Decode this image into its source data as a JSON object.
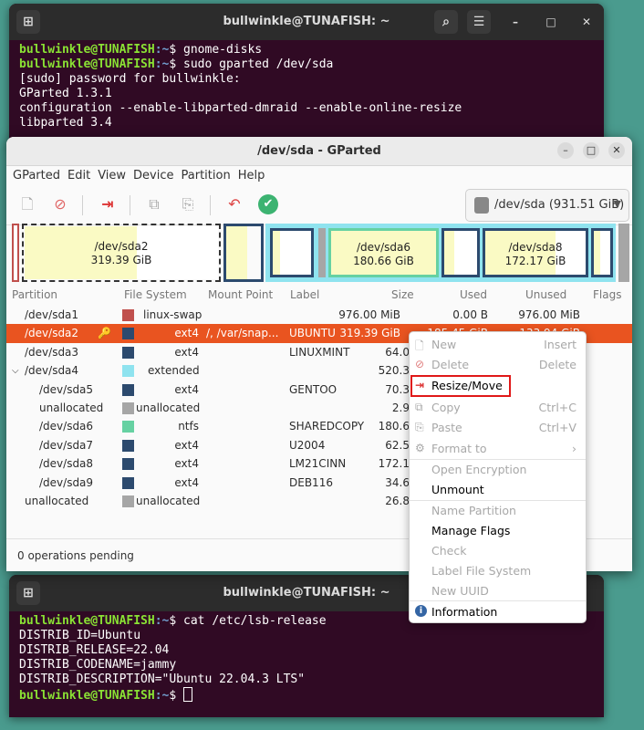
{
  "top_terminal": {
    "title": "bullwinkle@TUNAFISH: ~",
    "lines": [
      {
        "user": "bullwinkle@TUNAFISH",
        "path": ":~",
        "cmd": "$ gnome-disks"
      },
      {
        "user": "bullwinkle@TUNAFISH",
        "path": ":~",
        "cmd": "$ sudo gparted /dev/sda"
      },
      {
        "text": "[sudo] password for bullwinkle:"
      },
      {
        "text": "GParted 1.3.1"
      },
      {
        "text": "configuration --enable-libparted-dmraid --enable-online-resize"
      },
      {
        "text": "libparted 3.4"
      }
    ]
  },
  "gparted": {
    "title": "/dev/sda - GParted",
    "menu": [
      "GParted",
      "Edit",
      "View",
      "Device",
      "Partition",
      "Help"
    ],
    "device_selector": "/dev/sda (931.51 GiB)",
    "map": [
      {
        "name": "/dev/sda2",
        "size": "319.39 GiB"
      },
      {
        "name": "/dev/sda6",
        "size": "180.66 GiB"
      },
      {
        "name": "/dev/sda8",
        "size": "172.17 GiB"
      }
    ],
    "columns": [
      "Partition",
      "File System",
      "Mount Point",
      "Label",
      "Size",
      "Used",
      "Unused",
      "Flags"
    ],
    "rows": [
      {
        "partition": "/dev/sda1",
        "fs": "linux-swap",
        "color": "#c0504d",
        "mount": "",
        "label": "",
        "size": "976.00 MiB",
        "used": "0.00 B",
        "unused": "976.00 MiB"
      },
      {
        "partition": "/dev/sda2",
        "fs": "ext4",
        "color": "#2c4a6e",
        "mount": "/, /var/snap...",
        "label": "UBUNTU",
        "size": "319.39 GiB",
        "used": "185.45 GiB",
        "unused": "133.94 GiB"
      },
      {
        "partition": "/dev/sda3",
        "fs": "ext4",
        "color": "#2c4a6e",
        "mount": "",
        "label": "LINUXMINT",
        "size": "64.0",
        "used": "",
        "unused": ""
      },
      {
        "partition": "/dev/sda4",
        "fs": "extended",
        "color": "#8fe3ef",
        "mount": "",
        "label": "",
        "size": "520.3",
        "used": "",
        "unused": ""
      },
      {
        "partition": "/dev/sda5",
        "fs": "ext4",
        "color": "#2c4a6e",
        "mount": "",
        "label": "GENTOO",
        "size": "70.3",
        "used": "",
        "unused": ""
      },
      {
        "partition": "unallocated",
        "fs": "unallocated",
        "color": "#a6a6a6",
        "mount": "",
        "label": "",
        "size": "2.9",
        "used": "",
        "unused": ""
      },
      {
        "partition": "/dev/sda6",
        "fs": "ntfs",
        "color": "#66d1a2",
        "mount": "",
        "label": "SHAREDCOPY",
        "size": "180.6",
        "used": "",
        "unused": ""
      },
      {
        "partition": "/dev/sda7",
        "fs": "ext4",
        "color": "#2c4a6e",
        "mount": "",
        "label": "U2004",
        "size": "62.5",
        "used": "",
        "unused": ""
      },
      {
        "partition": "/dev/sda8",
        "fs": "ext4",
        "color": "#2c4a6e",
        "mount": "",
        "label": "LM21CINN",
        "size": "172.1",
        "used": "",
        "unused": ""
      },
      {
        "partition": "/dev/sda9",
        "fs": "ext4",
        "color": "#2c4a6e",
        "mount": "",
        "label": "DEB116",
        "size": "34.6",
        "used": "",
        "unused": ""
      },
      {
        "partition": "unallocated",
        "fs": "unallocated",
        "color": "#a6a6a6",
        "mount": "",
        "label": "",
        "size": "26.8",
        "used": "",
        "unused": ""
      }
    ],
    "status": "0 operations pending"
  },
  "context_menu": {
    "new": "New",
    "new_accel": "Insert",
    "delete": "Delete",
    "delete_accel": "Delete",
    "resize": "Resize/Move",
    "copy": "Copy",
    "copy_accel": "Ctrl+C",
    "paste": "Paste",
    "paste_accel": "Ctrl+V",
    "format": "Format to",
    "open_enc": "Open Encryption",
    "unmount": "Unmount",
    "name_part": "Name Partition",
    "flags": "Manage Flags",
    "check": "Check",
    "label_fs": "Label File System",
    "uuid": "New UUID",
    "info": "Information"
  },
  "bottom_terminal": {
    "title": "bullwinkle@TUNAFISH: ~",
    "lines": [
      {
        "user": "bullwinkle@TUNAFISH",
        "path": ":~",
        "cmd": "$ cat /etc/lsb-release"
      },
      {
        "text": "DISTRIB_ID=Ubuntu"
      },
      {
        "text": "DISTRIB_RELEASE=22.04"
      },
      {
        "text": "DISTRIB_CODENAME=jammy"
      },
      {
        "text": "DISTRIB_DESCRIPTION=\"Ubuntu 22.04.3 LTS\""
      },
      {
        "user": "bullwinkle@TUNAFISH",
        "path": ":~",
        "cmd": "$ "
      }
    ]
  }
}
